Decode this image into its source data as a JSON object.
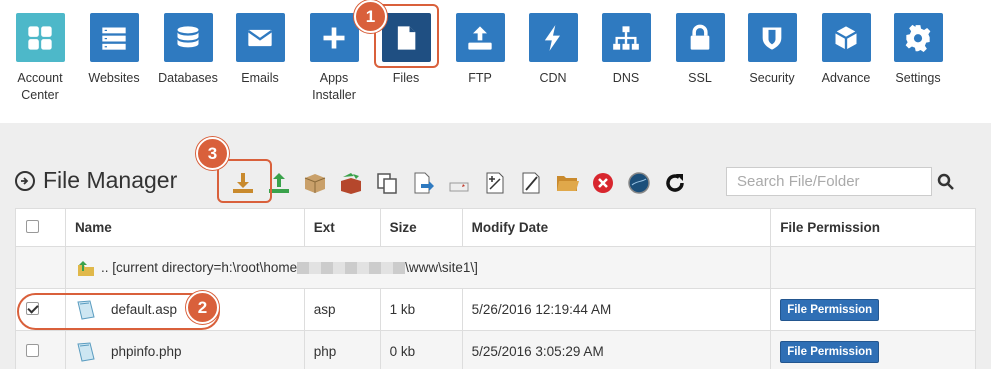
{
  "nav": {
    "items": [
      {
        "label": "Account\nCenter",
        "icon": "grid-icon",
        "color": "#4db8c9"
      },
      {
        "label": "Websites",
        "icon": "server-icon"
      },
      {
        "label": "Databases",
        "icon": "database-icon"
      },
      {
        "label": "Emails",
        "icon": "envelope-icon"
      },
      {
        "label": "Apps\nInstaller",
        "icon": "plus-icon"
      },
      {
        "label": "Files",
        "icon": "file-icon",
        "color": "#1f4f82"
      },
      {
        "label": "FTP",
        "icon": "upload-drive-icon"
      },
      {
        "label": "CDN",
        "icon": "bolt-icon"
      },
      {
        "label": "DNS",
        "icon": "sitemap-icon"
      },
      {
        "label": "SSL",
        "icon": "lock-icon"
      },
      {
        "label": "Security",
        "icon": "shield-icon"
      },
      {
        "label": "Advance",
        "icon": "cube-icon"
      },
      {
        "label": "Settings",
        "icon": "gear-icon"
      }
    ]
  },
  "badges": {
    "one": "1",
    "two": "2",
    "three": "3"
  },
  "file_manager": {
    "title": "File Manager",
    "search_placeholder": "Search File/Folder"
  },
  "table": {
    "headers": {
      "name": "Name",
      "ext": "Ext",
      "size": "Size",
      "modify": "Modify Date",
      "perm": "File Permission"
    },
    "current_dir": {
      "prefix": ".. [current directory=h:\\root\\home",
      "suffix": "\\www\\site1\\]"
    },
    "rows": [
      {
        "name": "default.asp",
        "ext": "asp",
        "size": "1 kb",
        "modify": "5/26/2016 12:19:44 AM",
        "perm": "File Permission",
        "checked": true
      },
      {
        "name": "phpinfo.php",
        "ext": "php",
        "size": "0 kb",
        "modify": "5/25/2016 3:05:29 AM",
        "perm": "File Permission",
        "checked": false
      }
    ]
  },
  "colors": {
    "accent": "#2f7ac0",
    "highlight": "#d9603b",
    "files_tile": "#1f4f82",
    "account_tile": "#4db8c9"
  }
}
